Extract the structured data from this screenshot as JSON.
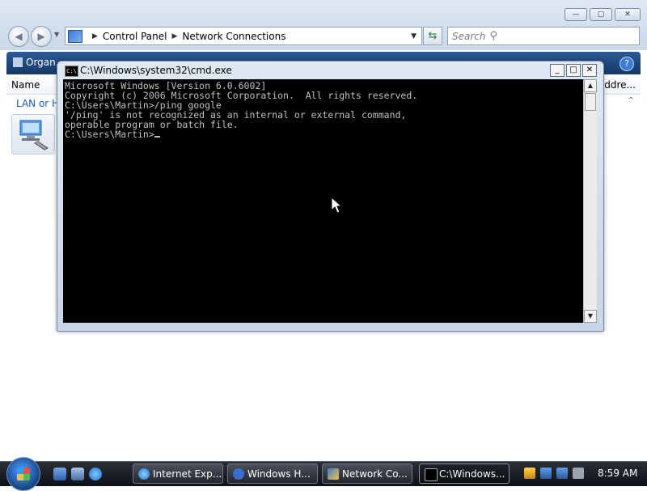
{
  "explorer": {
    "breadcrumb": [
      "Control Panel",
      "Network Connections"
    ],
    "search_placeholder": "Search",
    "commandbar": {
      "organize_label": "Organ"
    },
    "columns": {
      "name": "Name",
      "address": "Addre..."
    },
    "group_label": "LAN or H",
    "window_buttons": {
      "minimize": "—",
      "maximize": "▢",
      "close": "✕"
    }
  },
  "cmd": {
    "title": "C:\\Windows\\system32\\cmd.exe",
    "console_lines": [
      "Microsoft Windows [Version 6.0.6002]",
      "Copyright (c) 2006 Microsoft Corporation.  All rights reserved.",
      "",
      "C:\\Users\\Martin>/ping google",
      "'/ping' is not recognized as an internal or external command,",
      "operable program or batch file.",
      "",
      "C:\\Users\\Martin>"
    ]
  },
  "taskbar": {
    "tasks": [
      "Internet Exp...",
      "Windows H...",
      "Network Co...",
      "C:\\Windows..."
    ],
    "active_task": 3,
    "clock": "8:59 AM"
  },
  "icons": {
    "back": "back-arrow-icon",
    "forward": "forward-arrow-icon",
    "refresh": "refresh-icon",
    "search": "search-icon",
    "help": "help-icon",
    "network": "network-connection-icon",
    "start": "windows-start-orb"
  },
  "colors": {
    "console_bg": "#000000",
    "console_text": "#c0c0c0",
    "commandbar_bg": "#1f4a84",
    "taskbar_bg": "#15191f"
  }
}
